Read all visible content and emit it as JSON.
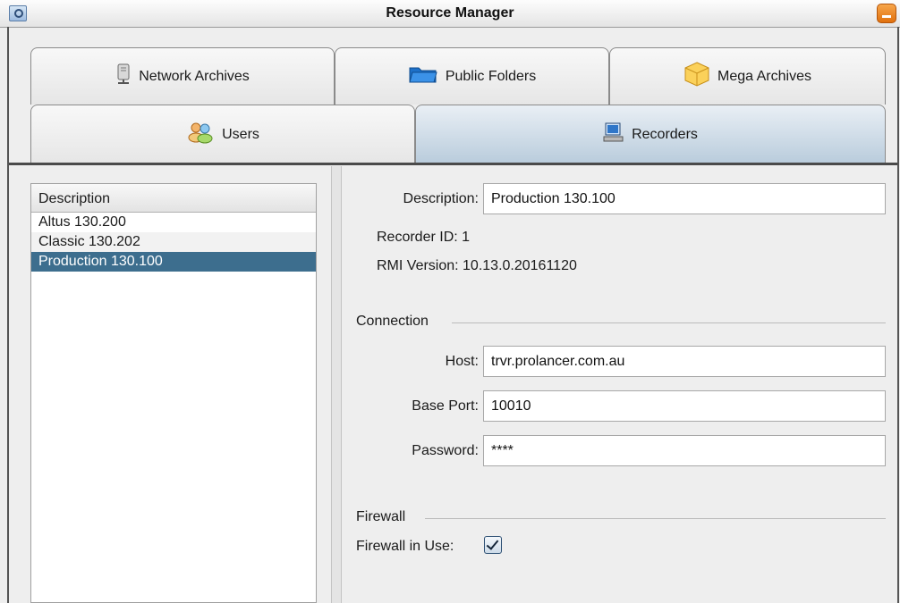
{
  "window": {
    "title": "Resource Manager"
  },
  "tabs": {
    "row1": [
      {
        "label": "Network Archives",
        "icon": "server-icon"
      },
      {
        "label": "Public Folders",
        "icon": "folder-icon"
      },
      {
        "label": "Mega Archives",
        "icon": "box-icon"
      }
    ],
    "row2": [
      {
        "label": "Users",
        "icon": "users-icon"
      },
      {
        "label": "Recorders",
        "icon": "computer-icon",
        "selected": true
      }
    ]
  },
  "list": {
    "header": "Description",
    "items": [
      "Altus 130.200",
      "Classic 130.202",
      "Production 130.100"
    ],
    "selected_index": 2
  },
  "form": {
    "description_label": "Description:",
    "description_value": "Production 130.100",
    "recorder_id_text": "Recorder ID: 1",
    "rmi_version_text": "RMI Version: 10.13.0.20161120",
    "connection_group": "Connection",
    "host_label": "Host:",
    "host_value": "trvr.prolancer.com.au",
    "base_port_label": "Base Port:",
    "base_port_value": "10010",
    "password_label": "Password:",
    "password_value": "****",
    "firewall_group": "Firewall",
    "firewall_label": "Firewall in Use:",
    "firewall_checked": true
  },
  "colors": {
    "selection": "#3d6e8e",
    "selected_tab": "#b9ccdc",
    "minimize_button": "#e0700d"
  }
}
